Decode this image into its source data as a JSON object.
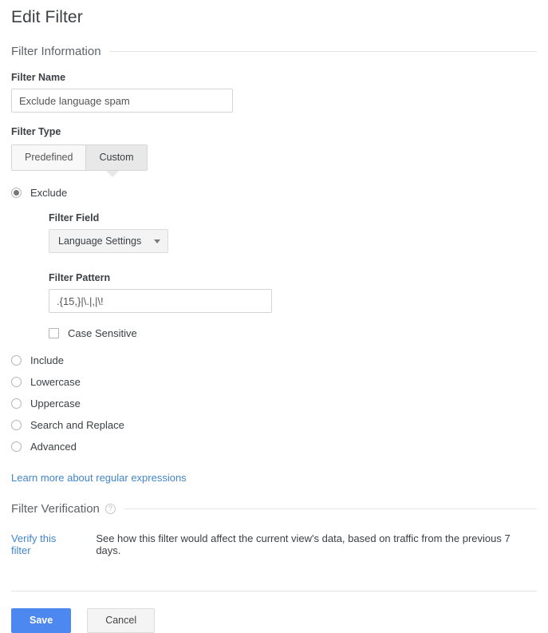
{
  "page": {
    "title": "Edit Filter"
  },
  "filter_information": {
    "heading": "Filter Information",
    "name_label": "Filter Name",
    "name_value": "Exclude language spam",
    "name_placeholder": "",
    "type_label": "Filter Type",
    "tabs": [
      {
        "label": "Predefined",
        "selected": false
      },
      {
        "label": "Custom",
        "selected": true
      }
    ]
  },
  "filter_options": {
    "exclude": {
      "label": "Exclude",
      "selected": true,
      "field_label": "Filter Field",
      "field_value": "Language Settings",
      "pattern_label": "Filter Pattern",
      "pattern_value": ".{15,}|\\.|,|\\!",
      "pattern_placeholder": "",
      "case_sensitive_label": "Case Sensitive",
      "case_sensitive_checked": false
    },
    "others": [
      {
        "label": "Include",
        "selected": false
      },
      {
        "label": "Lowercase",
        "selected": false
      },
      {
        "label": "Uppercase",
        "selected": false
      },
      {
        "label": "Search and Replace",
        "selected": false
      },
      {
        "label": "Advanced",
        "selected": false
      }
    ],
    "regex_link": "Learn more about regular expressions"
  },
  "filter_verification": {
    "heading": "Filter Verification",
    "help_icon": "help-circle-icon",
    "verify_link": "Verify this filter",
    "description": "See how this filter would affect the current view's data, based on traffic from the previous 7 days."
  },
  "footer": {
    "save_label": "Save",
    "cancel_label": "Cancel"
  },
  "colors": {
    "primary_button": "#4d88f0",
    "link": "#4285c9",
    "text": "#3c4043"
  }
}
